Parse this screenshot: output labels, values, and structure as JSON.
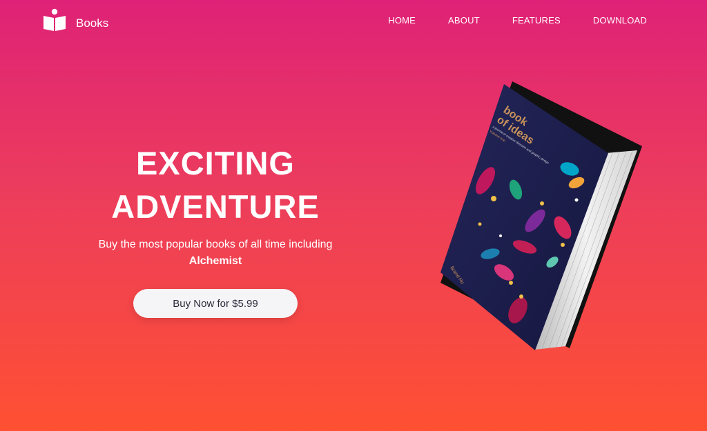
{
  "brand": {
    "name": "Books",
    "icon": "open-book-icon"
  },
  "nav": [
    {
      "label": "HOME"
    },
    {
      "label": "ABOUT"
    },
    {
      "label": "FEATURES"
    },
    {
      "label": "DOWNLOAD"
    }
  ],
  "hero": {
    "title_line1": "EXCITING",
    "title_line2": "ADVENTURE",
    "subtitle": "Buy the most popular books of all time including",
    "highlight": "Alchemist",
    "cta_label": "Buy Now for $5.99"
  },
  "book": {
    "cover_title_line1": "book",
    "cover_title_line2": "of ideas",
    "cover_tagline": "a journal of creative direction and graphic design",
    "cover_edition": "Volume one",
    "cover_author": "Brand Nu"
  },
  "colors": {
    "gradient_top": "#df2277",
    "gradient_bottom": "#ff5032",
    "cover": "#1d1e4e",
    "cover_title": "#c8925a"
  }
}
